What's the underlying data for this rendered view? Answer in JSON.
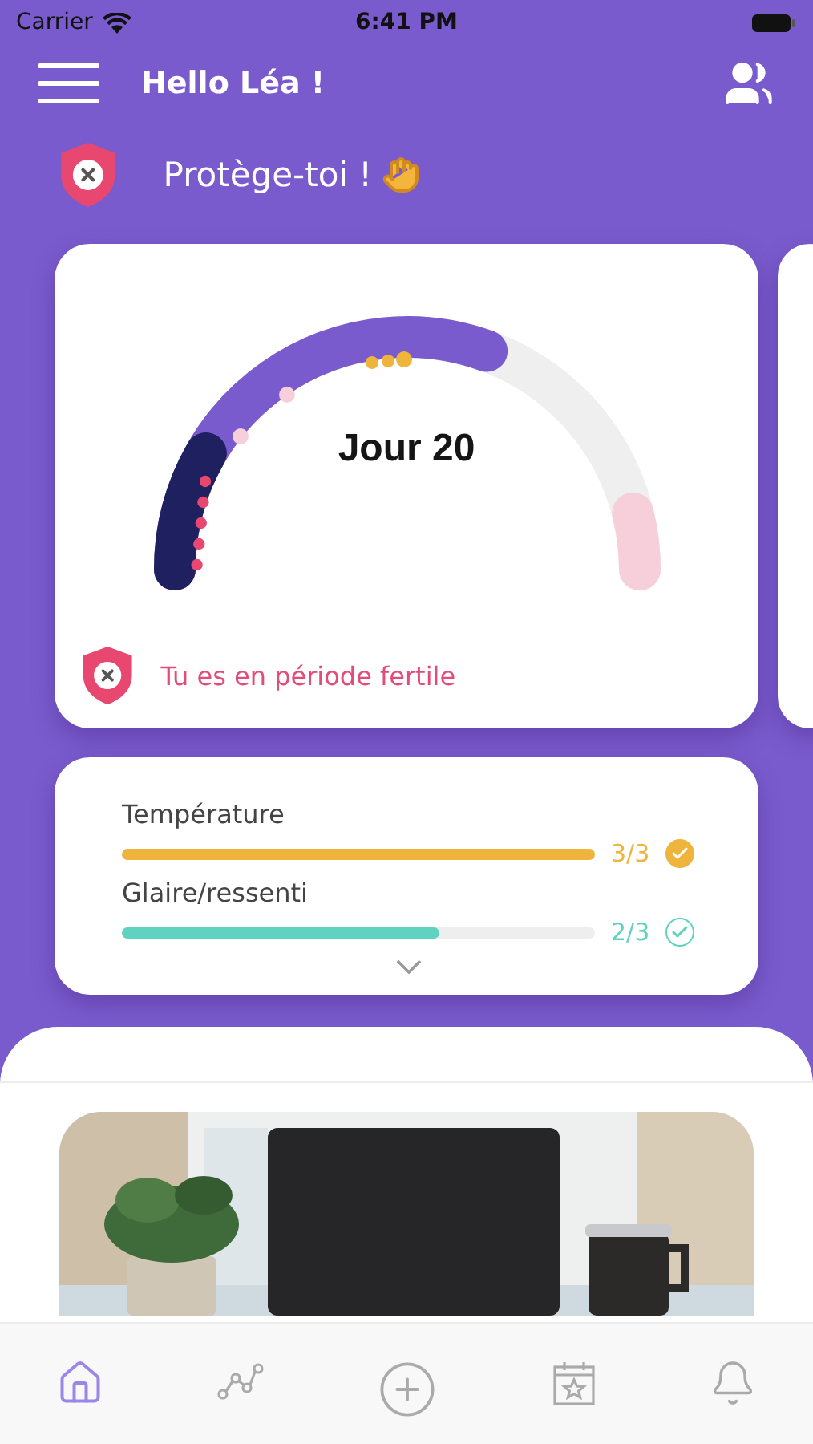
{
  "status_bar": {
    "carrier": "Carrier",
    "time": "6:41 PM"
  },
  "header": {
    "greeting": "Hello Léa !"
  },
  "alert": {
    "text": "Protège-toi !"
  },
  "cycle_card": {
    "day_label": "Jour 20",
    "status": "Tu es en période fertile"
  },
  "metrics": [
    {
      "label": "Température",
      "level": 1,
      "reading": "3/3",
      "color": "#efb43b"
    },
    {
      "label": "Glaire/ressenti",
      "level": 0.67,
      "reading": "2/3",
      "color": "#5fd3c0"
    }
  ],
  "tabs": [
    {
      "kind": "home",
      "selected": true
    },
    {
      "kind": "stats",
      "selected": false
    },
    {
      "kind": "add",
      "selected": false
    },
    {
      "kind": "calendar",
      "selected": false
    },
    {
      "kind": "notifications",
      "selected": false
    }
  ]
}
